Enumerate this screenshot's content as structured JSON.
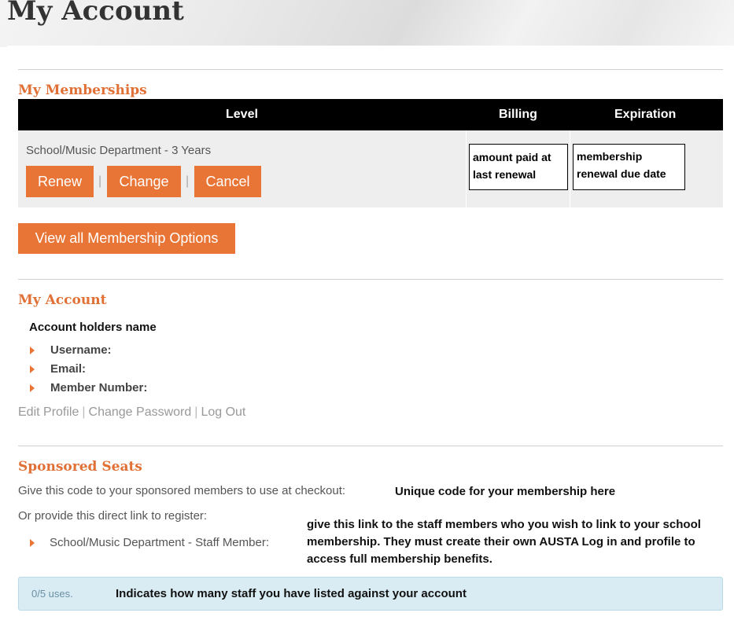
{
  "page": {
    "title": "My Account"
  },
  "memberships": {
    "section_title": "My Memberships",
    "columns": {
      "level": "Level",
      "billing": "Billing",
      "expiration": "Expiration"
    },
    "row": {
      "level": "School/Music Department - 3 Years",
      "actions": {
        "renew": "Renew",
        "change": "Change",
        "cancel": "Cancel"
      },
      "separator": "|",
      "billing_note": "amount paid at last renewal",
      "expiration_note": "membership renewal due date"
    },
    "view_all_button": "View all Membership Options"
  },
  "account": {
    "section_title": "My Account",
    "holder_name": "Account holders name",
    "fields": {
      "username": "Username:",
      "email": "Email:",
      "member_number": "Member Number:"
    },
    "links": {
      "edit_profile": "Edit Profile",
      "change_password": "Change Password",
      "log_out": "Log Out",
      "separator": "|"
    }
  },
  "sponsored": {
    "section_title": "Sponsored Seats",
    "code_prompt": "Give this code to your sponsored members to use at checkout:",
    "code_note": "Unique code for your membership here",
    "link_prompt": "Or provide this direct link to register:",
    "staff_link_label": "School/Music Department - Staff Member:",
    "link_note": "give this link to the staff members who you wish to link to your school membership. They must create their own AUSTA Log in and profile to access full membership benefits.",
    "usage_count": "0/5 uses.",
    "usage_note": "Indicates how many staff you have listed against your account"
  },
  "colors": {
    "accent": "#e87435",
    "heading": "#e07035",
    "table_header": "#000000",
    "info_bg": "#d9ecf4"
  },
  "icons": {
    "bullet": "caret-right-icon"
  }
}
